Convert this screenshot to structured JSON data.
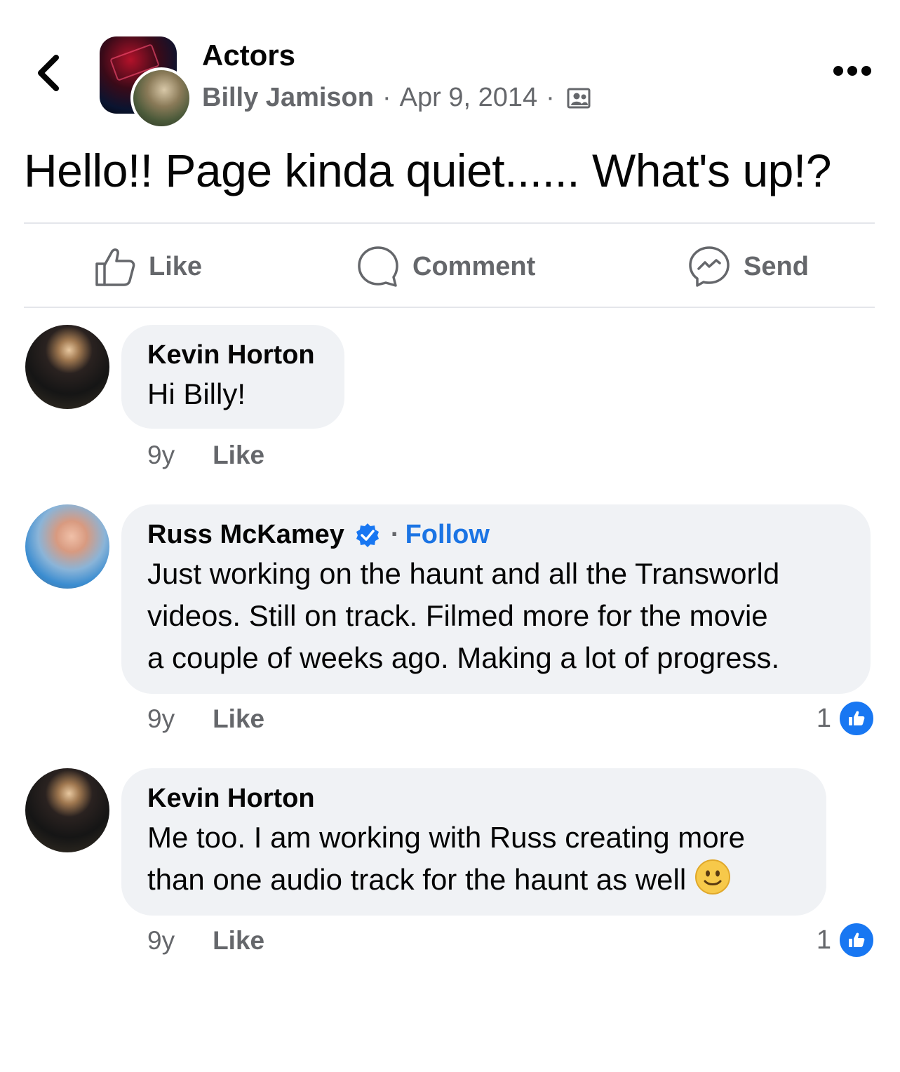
{
  "header": {
    "group_name": "Actors",
    "author": "Billy Jamison",
    "date": "Apr 9, 2014",
    "separator": "·"
  },
  "post": {
    "text": "Hello!! Page kinda quiet...... What's up!?"
  },
  "actions": {
    "like": "Like",
    "comment": "Comment",
    "send": "Send"
  },
  "comments": [
    {
      "name": "Kevin Horton",
      "text": "Hi Billy!",
      "age": "9y",
      "like_label": "Like"
    },
    {
      "name": "Russ McKamey",
      "verified": true,
      "follow_label": "Follow",
      "text_lines": [
        "Just working on the haunt and all the Transworld",
        "videos. Still on track. Filmed more for the movie",
        "a couple of weeks ago. Making a lot of progress."
      ],
      "age": "9y",
      "like_label": "Like",
      "reaction_count": "1"
    },
    {
      "name": "Kevin Horton",
      "text_lines": [
        "Me too. I am working with Russ creating more",
        "than one audio track for the haunt as well"
      ],
      "emoji": "slightly-smiling-face",
      "age": "9y",
      "like_label": "Like",
      "reaction_count": "1"
    }
  ],
  "colors": {
    "link_blue": "#1b74e4",
    "like_blue": "#1877f2",
    "secondary_text": "#65676b",
    "bubble_bg": "#f0f2f5"
  }
}
